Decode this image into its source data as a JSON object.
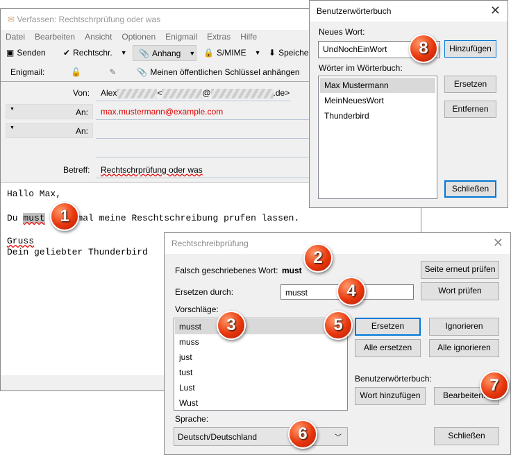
{
  "compose": {
    "title": "Verfassen: Rechtschrprüfung oder was",
    "menu": [
      "Datei",
      "Bearbeiten",
      "Ansicht",
      "Optionen",
      "Enigmail",
      "Extras",
      "Hilfe"
    ],
    "toolbar": {
      "send": "Senden",
      "spell": "Rechtschr.",
      "attach": "Anhang",
      "smime": "S/MIME",
      "save": "Speiche"
    },
    "enigmail": {
      "label": "Enigmail:",
      "attach_key": "Meinen öffentlichen Schlüssel anhängen"
    },
    "from_label": "Von:",
    "from_name": "Alex",
    "from_lt": "<",
    "from_at": "@",
    "from_domain_end": ".de>",
    "to_label": "An:",
    "to_value": "max.mustermann@example.com",
    "to2_label": "An:",
    "subject_label": "Betreff:",
    "subject_value": "Rechtschrprüfung oder was",
    "body": {
      "line1": "Hallo Max,",
      "line2_pre": "Du ",
      "line2_word": "must",
      "line2_post": "      mal meine Reschtschreibung prufen lassen.",
      "line3": "Gruss",
      "line4": "Dein geliebter Thunderbird"
    }
  },
  "dict": {
    "title": "Benutzerwörterbuch",
    "new_word_label": "Neues Wort:",
    "new_word_value": "UndNochEinWort",
    "add": "Hinzufügen",
    "words_label": "Wörter im Wörterbuch:",
    "words": [
      "Max Mustermann",
      "MeinNeuesWort",
      "Thunderbird"
    ],
    "replace": "Ersetzen",
    "remove": "Entfernen",
    "close": "Schließen"
  },
  "spell": {
    "title": "Rechtschreibprüfung",
    "misspelled_label": "Falsch geschriebenes Wort:",
    "misspelled_word": "must",
    "replace_label": "Ersetzen durch:",
    "replace_value": "musst",
    "recheck": "Seite erneut prüfen",
    "check_word": "Wort prüfen",
    "suggestions_label": "Vorschläge:",
    "suggestions": [
      "musst",
      "muss",
      "just",
      "tust",
      "Lust",
      "Wust"
    ],
    "replace": "Ersetzen",
    "ignore": "Ignorieren",
    "replace_all": "Alle ersetzen",
    "ignore_all": "Alle ignorieren",
    "userdict_label": "Benutzerwörterbuch:",
    "add_word": "Wort hinzufügen",
    "edit": "Bearbeiten...",
    "language_label": "Sprache:",
    "language_value": "Deutsch/Deutschland",
    "close": "Schließen"
  },
  "badges": [
    "1",
    "2",
    "3",
    "4",
    "5",
    "6",
    "7",
    "8"
  ],
  "colors": {
    "badge": "#e8360c",
    "recipient": "#e00000",
    "focus": "#0078d7"
  }
}
